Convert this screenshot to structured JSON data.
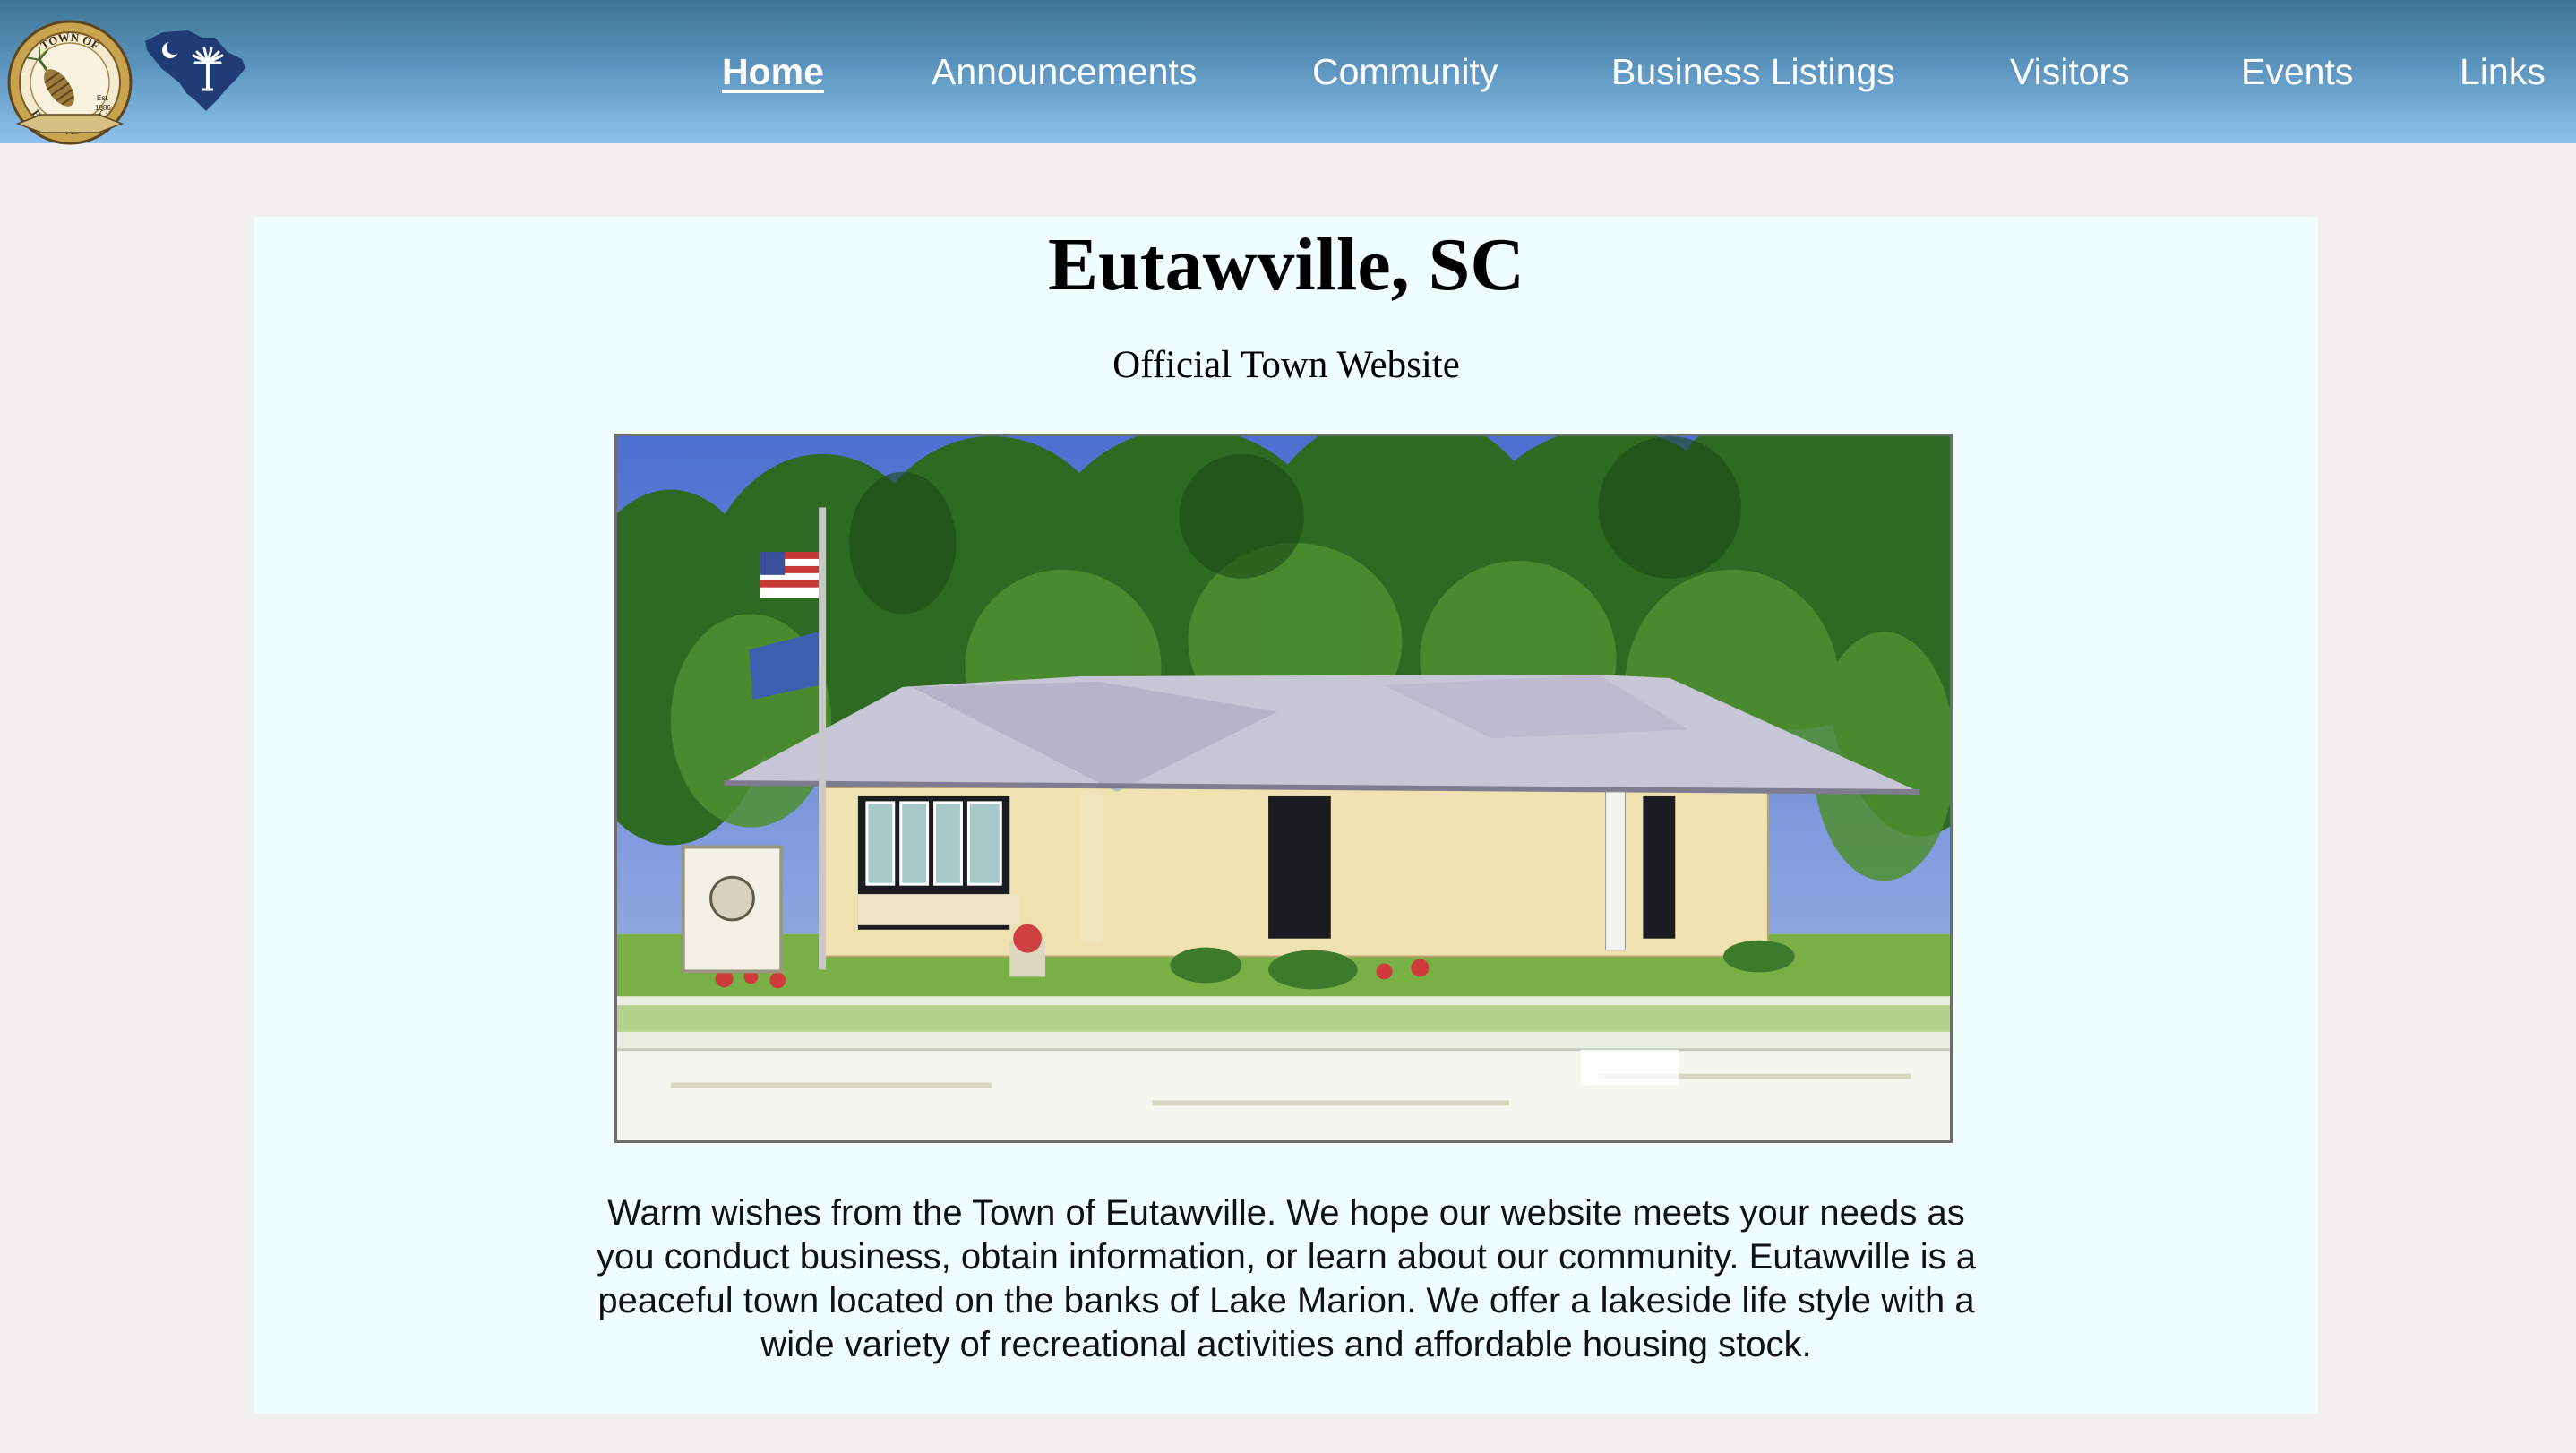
{
  "header": {
    "seal_alt": "Town of Eutawville, SC seal",
    "seal_text": {
      "top": "TOWN OF",
      "bottom": "EUTAWVILLE, SC",
      "est": "Est.",
      "year": "1886"
    },
    "nav": [
      {
        "label": "Home",
        "active": true
      },
      {
        "label": "Announcements",
        "active": false
      },
      {
        "label": "Community",
        "active": false
      },
      {
        "label": "Business Listings",
        "active": false
      },
      {
        "label": "Visitors",
        "active": false
      },
      {
        "label": "Events",
        "active": false
      },
      {
        "label": "Links",
        "active": false
      }
    ]
  },
  "main": {
    "title": "Eutawville, SC",
    "subtitle": "Official Town Website",
    "intro": "Warm wishes from the Town of Eutawville. We hope our website meets your needs as you conduct business, obtain information, or learn about our community. Eutawville is a peaceful town located on the banks of Lake Marion. We offer a lakeside life style with a wide variety of recreational activities and affordable housing stock."
  },
  "colors": {
    "header_top": "#3f7695",
    "header_bottom": "#8ec2ec",
    "panel_bg": "#f0fffe",
    "page_bg": "#f1f0ee",
    "sc_blue": "#1f3d74"
  },
  "icons": {
    "seal": "town-seal-icon",
    "state": "south-carolina-palmetto-icon"
  }
}
